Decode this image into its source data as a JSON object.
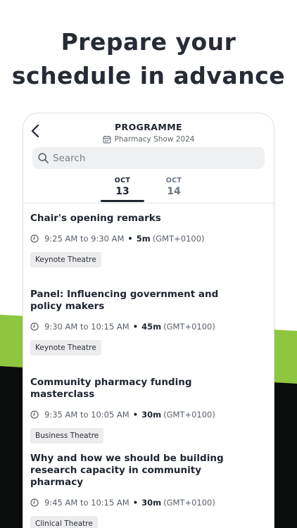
{
  "colors": {
    "accent_green": "#8ec63f",
    "dark_band": "#0b0d0c",
    "text_dark": "#1f2430",
    "tag_bg": "#ececee"
  },
  "headline": {
    "line1": "Prepare your",
    "line2": "schedule in advance"
  },
  "header": {
    "title": "PROGRAMME",
    "event_name": "Pharmacy Show 2024",
    "back_icon": "chevron-left-icon",
    "calendar_icon": "calendar-icon"
  },
  "search": {
    "placeholder": "Search",
    "value": "",
    "icon": "search-icon"
  },
  "tabs": [
    {
      "month": "OCT",
      "day": "13",
      "selected": true
    },
    {
      "month": "OCT",
      "day": "14",
      "selected": false
    }
  ],
  "sessions": [
    {
      "title_line1": "Chair's opening remarks",
      "title_line2": "",
      "start": "9:25 AM",
      "end": "9:30 AM",
      "to": "to",
      "duration": "5m",
      "tz": "(GMT+0100)",
      "venue": "Keynote Theatre"
    },
    {
      "title_line1": "Panel: Influencing government and",
      "title_line2": "policy makers",
      "start": "9:30 AM",
      "end": "10:15 AM",
      "to": "to",
      "duration": "45m",
      "tz": "(GMT+0100)",
      "venue": "Keynote Theatre"
    },
    {
      "title_line1": "Community pharmacy funding masterclass",
      "title_line2": "",
      "start": "9:35 AM",
      "end": "10:05 AM",
      "to": "to",
      "duration": "30m",
      "tz": "(GMT+0100)",
      "venue": "Business Theatre"
    },
    {
      "title_line1": "Why and how we should be building",
      "title_line2": "research capacity in community pharmacy",
      "start": "9:45 AM",
      "end": "10:15 AM",
      "to": "to",
      "duration": "30m",
      "tz": "(GMT+0100)",
      "venue": "Clinical Theatre"
    }
  ]
}
